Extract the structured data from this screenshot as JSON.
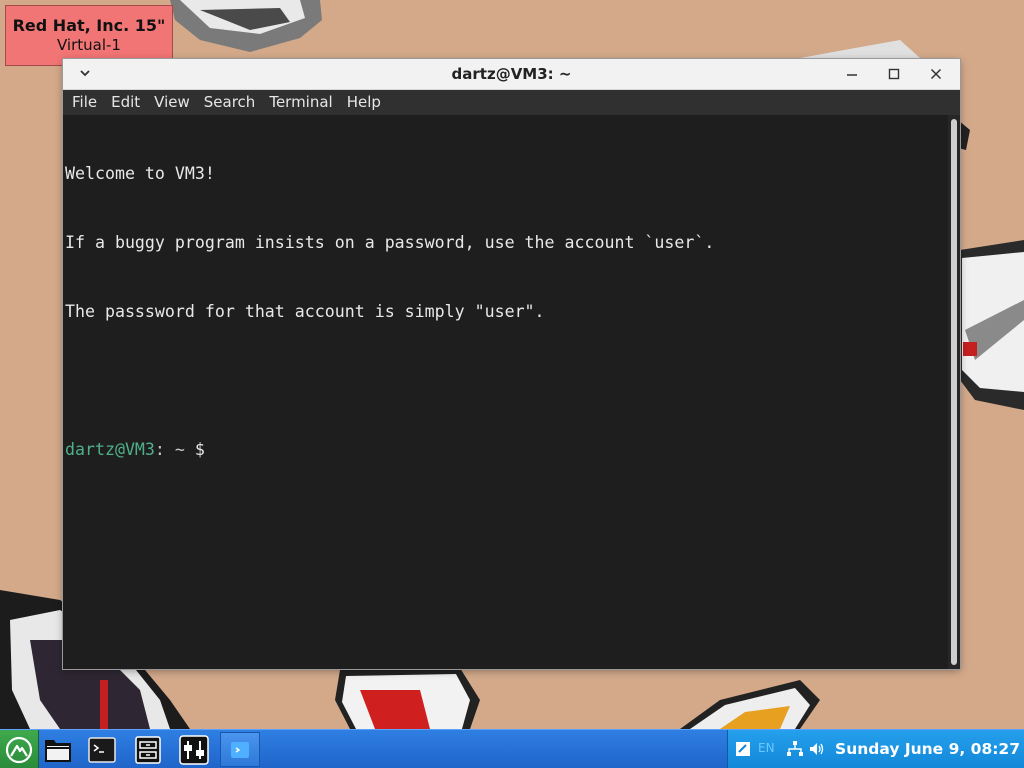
{
  "monitor": {
    "name": "Red Hat, Inc. 15\"",
    "output": "Virtual-1"
  },
  "window": {
    "title": "dartz@VM3: ~",
    "menu": [
      "File",
      "Edit",
      "View",
      "Search",
      "Terminal",
      "Help"
    ]
  },
  "terminal": {
    "lines": [
      "Welcome to VM3!",
      "If a buggy program insists on a password, use the account `user`.",
      "The passsword for that account is simply \"user\"."
    ],
    "prompt_user": "dartz@VM3",
    "prompt_sep": ":",
    "prompt_path": " ~",
    "prompt_symbol": "$"
  },
  "taskbar": {
    "clock": "Sunday June  9, 08:27",
    "keyboard_layout": "EN",
    "icons": [
      "start-menu-icon",
      "file-manager-icon",
      "terminal-icon",
      "archive-icon",
      "settings-icon",
      "window-icon"
    ]
  },
  "colors": {
    "desktop": "#d3a98a",
    "taskbar": "#1f64c9",
    "tray": "#1187d8",
    "prompt_user": "#4fb08a",
    "monitor_label": "#f27575"
  }
}
